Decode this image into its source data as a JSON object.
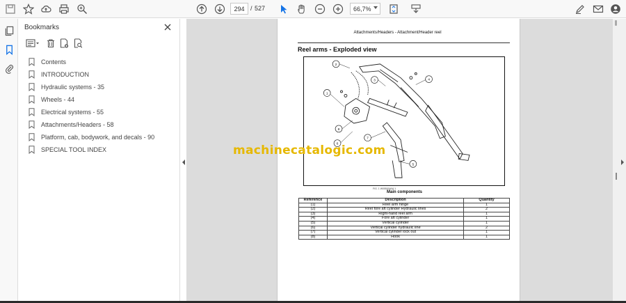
{
  "toolbar": {
    "page_current": "294",
    "page_separator": "/",
    "page_total": "527",
    "zoom": "66,7%"
  },
  "bookmarks_panel": {
    "title": "Bookmarks",
    "items": [
      {
        "label": "Contents"
      },
      {
        "label": "INTRODUCTION"
      },
      {
        "label": "Hydraulic systems - 35"
      },
      {
        "label": "Wheels - 44"
      },
      {
        "label": "Electrical systems - 55"
      },
      {
        "label": "Attachments/Headers - 58"
      },
      {
        "label": "Platform, cab, bodywork, and decals - 90"
      },
      {
        "label": "SPECIAL TOOL INDEX"
      }
    ]
  },
  "document": {
    "header": "Attachments/Headers - Attachment/Header reel",
    "section_title": "Reel arms - Exploded view",
    "figure_code": "FIG. 1 W05500A0A    1",
    "figure_caption": "Main components",
    "callouts": [
      "2",
      "3",
      "4",
      "1",
      "8",
      "6",
      "7",
      "5"
    ],
    "watermark": "machinecatalogic.com",
    "table": {
      "headers": [
        "Reference",
        "Description",
        "Quantity"
      ],
      "rows": [
        [
          "(1)",
          "Reel arm hinge",
          "1"
        ],
        [
          "(2)",
          "Reel fore aft cylinder Hydraulic lines",
          "2"
        ],
        [
          "(3)",
          "Right-hand reel arm",
          "1"
        ],
        [
          "(4)",
          "Fore aft cylinder",
          "1"
        ],
        [
          "(5)",
          "Vertical cylinder",
          "1"
        ],
        [
          "(6)",
          "Vertical cylinder hydraulic line",
          "2"
        ],
        [
          "(7)",
          "Vertical cylinder lock out",
          "1"
        ],
        [
          "(8)",
          "Hook",
          "1"
        ]
      ]
    }
  },
  "colors": {
    "accent": "#1473e6",
    "watermark": "#e6b800",
    "viewport_bg": "#dcdcdc"
  }
}
